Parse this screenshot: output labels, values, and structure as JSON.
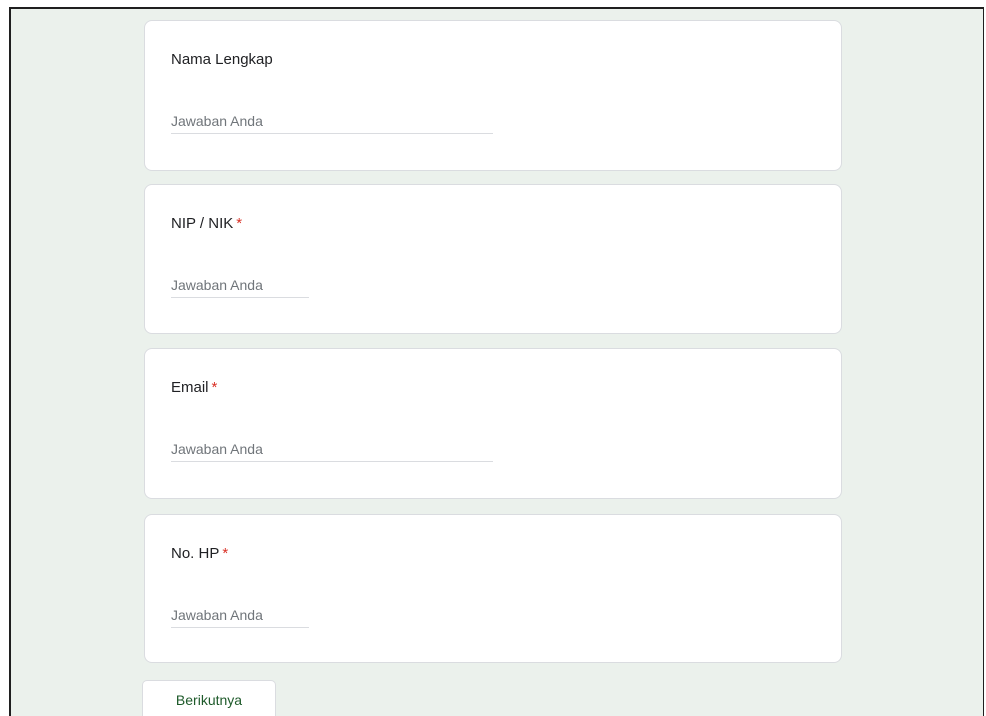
{
  "questions": [
    {
      "label": "Nama Lengkap",
      "required_mark": "",
      "placeholder": "Jawaban Anda"
    },
    {
      "label": "NIP / NIK",
      "required_mark": "*",
      "placeholder": "Jawaban Anda"
    },
    {
      "label": "Email",
      "required_mark": "*",
      "placeholder": "Jawaban Anda"
    },
    {
      "label": "No. HP",
      "required_mark": "*",
      "placeholder": "Jawaban Anda"
    }
  ],
  "navigation": {
    "next_label": "Berikutnya"
  },
  "colors": {
    "page_background": "#ebf1ec",
    "required_mark": "#d93025",
    "button_text": "#1e5a2a"
  }
}
